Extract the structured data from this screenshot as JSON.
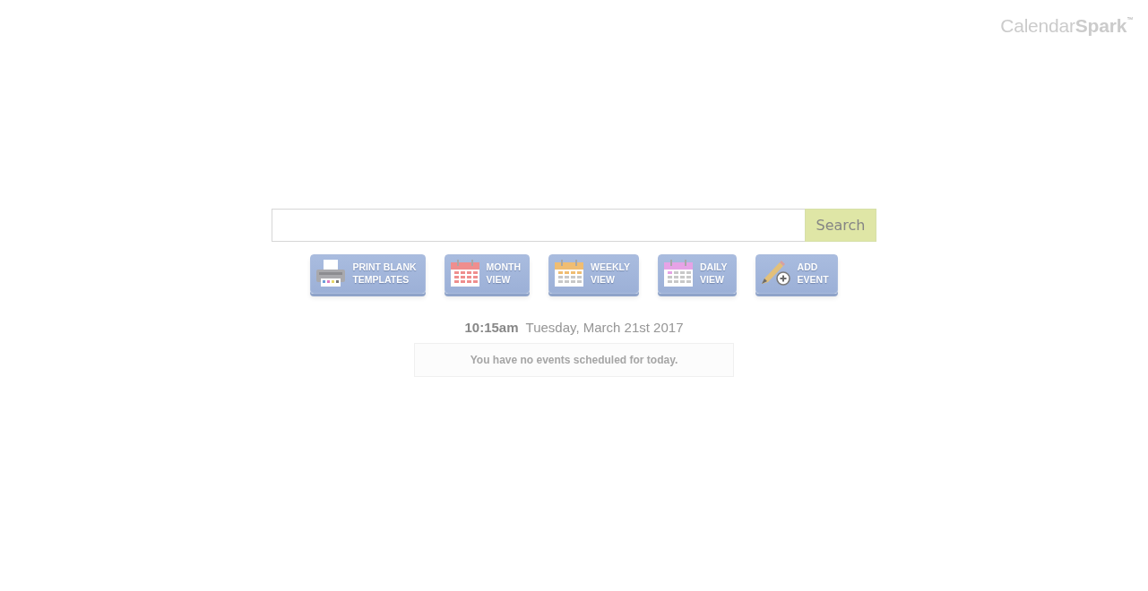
{
  "logo": {
    "text": "Calendar**Spark**$^{™}$"
  },
  "search": {
    "button": "Search"
  },
  "actions": [
    {
      "kind": "printer",
      "lines": [
        "PRINT BLANK",
        "TEMPLATES"
      ]
    },
    {
      "kind": "month",
      "color": "#ef8e8e",
      "lines": [
        "MONTH",
        "VIEW"
      ]
    },
    {
      "kind": "week",
      "color": "#f0bd72",
      "lines": [
        "WEEKLY",
        "VIEW"
      ]
    },
    {
      "kind": "day",
      "color": "#e6a3e6",
      "lines": [
        "DAILY",
        "VIEW"
      ]
    },
    {
      "kind": "add",
      "lines": [
        "ADD",
        "EVENT"
      ]
    }
  ],
  "now": {
    "time": "10:15am",
    "date": "Tuesday, March 21st 2017"
  },
  "notice": "You have no events scheduled for today."
}
